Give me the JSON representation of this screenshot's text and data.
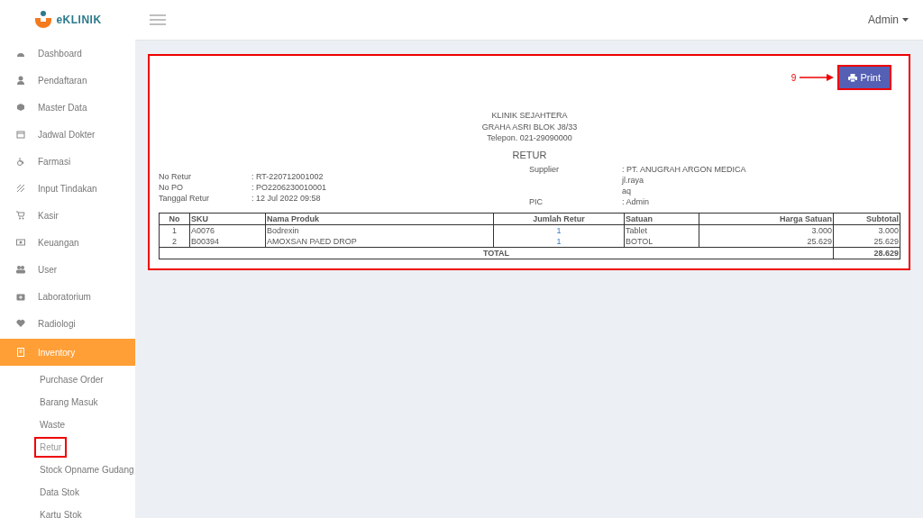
{
  "brand": {
    "name": "eKLINIK"
  },
  "header": {
    "user": "Admin"
  },
  "sidebar": {
    "items": [
      {
        "label": "Dashboard",
        "selected": false
      },
      {
        "label": "Pendaftaran",
        "selected": false
      },
      {
        "label": "Master Data",
        "selected": false
      },
      {
        "label": "Jadwal Dokter",
        "selected": false
      },
      {
        "label": "Farmasi",
        "selected": false
      },
      {
        "label": "Input Tindakan",
        "selected": false
      },
      {
        "label": "Kasir",
        "selected": false
      },
      {
        "label": "Keuangan",
        "selected": false
      },
      {
        "label": "User",
        "selected": false
      },
      {
        "label": "Laboratorium",
        "selected": false
      },
      {
        "label": "Radiologi",
        "selected": false
      },
      {
        "label": "Inventory",
        "selected": true,
        "children": [
          {
            "label": "Purchase Order",
            "selected": false,
            "highlighted": false
          },
          {
            "label": "Barang Masuk",
            "selected": false,
            "highlighted": false
          },
          {
            "label": "Waste",
            "selected": false,
            "highlighted": false
          },
          {
            "label": "Retur",
            "selected": true,
            "highlighted": true
          },
          {
            "label": "Stock Opname Gudang",
            "selected": false,
            "highlighted": false
          },
          {
            "label": "Data Stok",
            "selected": false,
            "highlighted": false
          },
          {
            "label": "Kartu Stok",
            "selected": false,
            "highlighted": false
          }
        ]
      }
    ]
  },
  "annotation": {
    "number": "9"
  },
  "print_button": {
    "label": "Print",
    "highlighted": true
  },
  "document": {
    "clinic": [
      "KLINIK SEJAHTERA",
      "GRAHA ASRI BLOK J8/33",
      "Telepon. 021-29090000"
    ],
    "title": "RETUR",
    "info": [
      {
        "label": "No Retur",
        "value": ": RT-220712001002"
      },
      {
        "label": "No PO",
        "value": ": PO2206230010001"
      },
      {
        "label": "Tanggal Retur",
        "value": ": 12 Jul 2022 09:58"
      }
    ],
    "supplier": {
      "label": "Supplier",
      "lines": [
        ": PT. ANUGRAH ARGON MEDICA",
        "jl.raya",
        "aq"
      ]
    },
    "pic": {
      "label": "PIC",
      "value": ": Admin"
    },
    "table": {
      "columns": [
        "No",
        "SKU",
        "Nama Produk",
        "Jumlah Retur",
        "Satuan",
        "Harga Satuan",
        "Subtotal"
      ],
      "rows": [
        [
          "1",
          "A0076",
          "Bodrexin",
          "1",
          "Tablet",
          "3.000",
          "3.000"
        ],
        [
          "2",
          "B00394",
          "AMOXSAN PAED DROP",
          "1",
          "BOTOL",
          "25.629",
          "25.629"
        ]
      ],
      "total_label": "TOTAL",
      "total": "28.629"
    }
  }
}
